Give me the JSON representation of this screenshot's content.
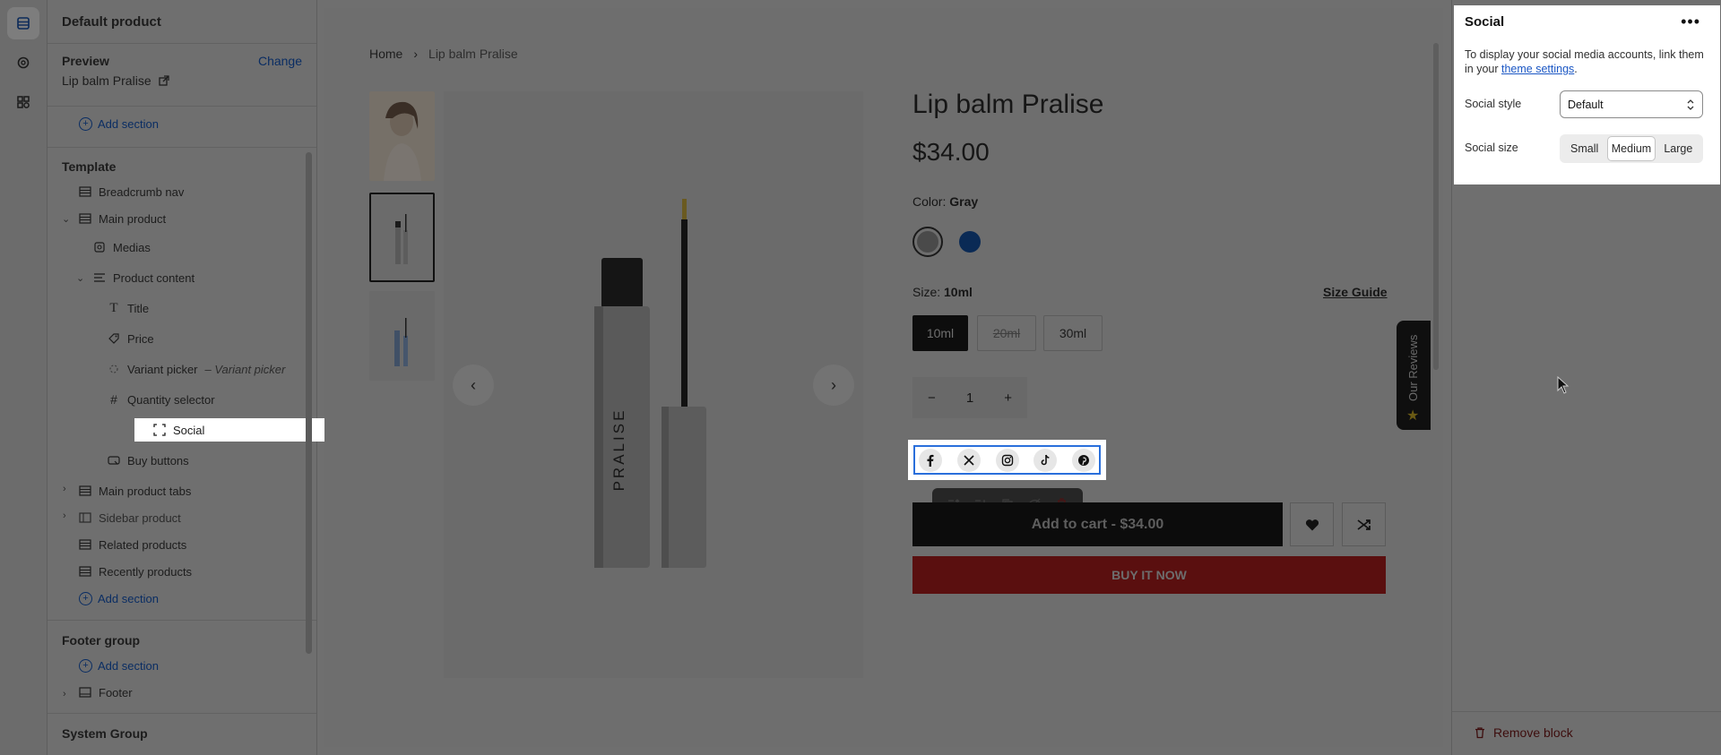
{
  "rail": {
    "items": [
      {
        "icon": "sections-icon",
        "active": true
      },
      {
        "icon": "settings-gear-icon",
        "active": false
      },
      {
        "icon": "apps-icon",
        "active": false
      }
    ]
  },
  "sidebar": {
    "title": "Default product",
    "preview_label": "Preview",
    "preview_change": "Change",
    "preview_value": "Lip balm Pralise",
    "add_section_label": "Add section",
    "template_label": "Template",
    "items": [
      {
        "label": "Breadcrumb nav"
      },
      {
        "label": "Main product"
      },
      {
        "label": "Medias"
      },
      {
        "label": "Product content"
      },
      {
        "label": "Title"
      },
      {
        "label": "Price"
      },
      {
        "label": "Variant picker",
        "suffix": "– Variant picker"
      },
      {
        "label": "Quantity selector"
      },
      {
        "label": "Social"
      },
      {
        "label": "Buy buttons"
      },
      {
        "label": "Main product tabs"
      },
      {
        "label": "Sidebar product"
      },
      {
        "label": "Related products"
      },
      {
        "label": "Recently products"
      }
    ],
    "footer_group_label": "Footer group",
    "footer_label": "Footer",
    "system_group_label": "System Group"
  },
  "canvas": {
    "breadcrumb": {
      "home": "Home",
      "separator": "›",
      "current": "Lip balm Pralise"
    },
    "product": {
      "title": "Lip balm Pralise",
      "price": "$34.00",
      "color_label": "Color:",
      "color_value": "Gray",
      "swatches": [
        {
          "name": "Gray",
          "color": "#4a4a4a"
        },
        {
          "name": "Blue",
          "color": "#0a2a55"
        }
      ],
      "size_label": "Size:",
      "size_value": "10ml",
      "size_guide": "Size Guide",
      "sizes": [
        "10ml",
        "20ml",
        "30ml"
      ],
      "quantity": "1",
      "qty_minus": "−",
      "qty_plus": "+",
      "add_to_cart": "Add to cart - $34.00",
      "buy_now": "BUY IT NOW",
      "image_text": "PRALISE"
    },
    "social_icons": [
      "facebook-icon",
      "x-icon",
      "instagram-icon",
      "tiktok-icon",
      "pinterest-icon"
    ],
    "reviews_tab": "Our Reviews"
  },
  "settings_panel": {
    "title": "Social",
    "more": "•••",
    "description_prefix": "To display your social media accounts, link them in your ",
    "description_link": "theme settings",
    "description_suffix": ".",
    "style_label": "Social style",
    "style_value": "Default",
    "size_label": "Social size",
    "size_options": [
      "Small",
      "Medium",
      "Large"
    ],
    "size_selected": "Medium",
    "remove_block": "Remove block"
  }
}
